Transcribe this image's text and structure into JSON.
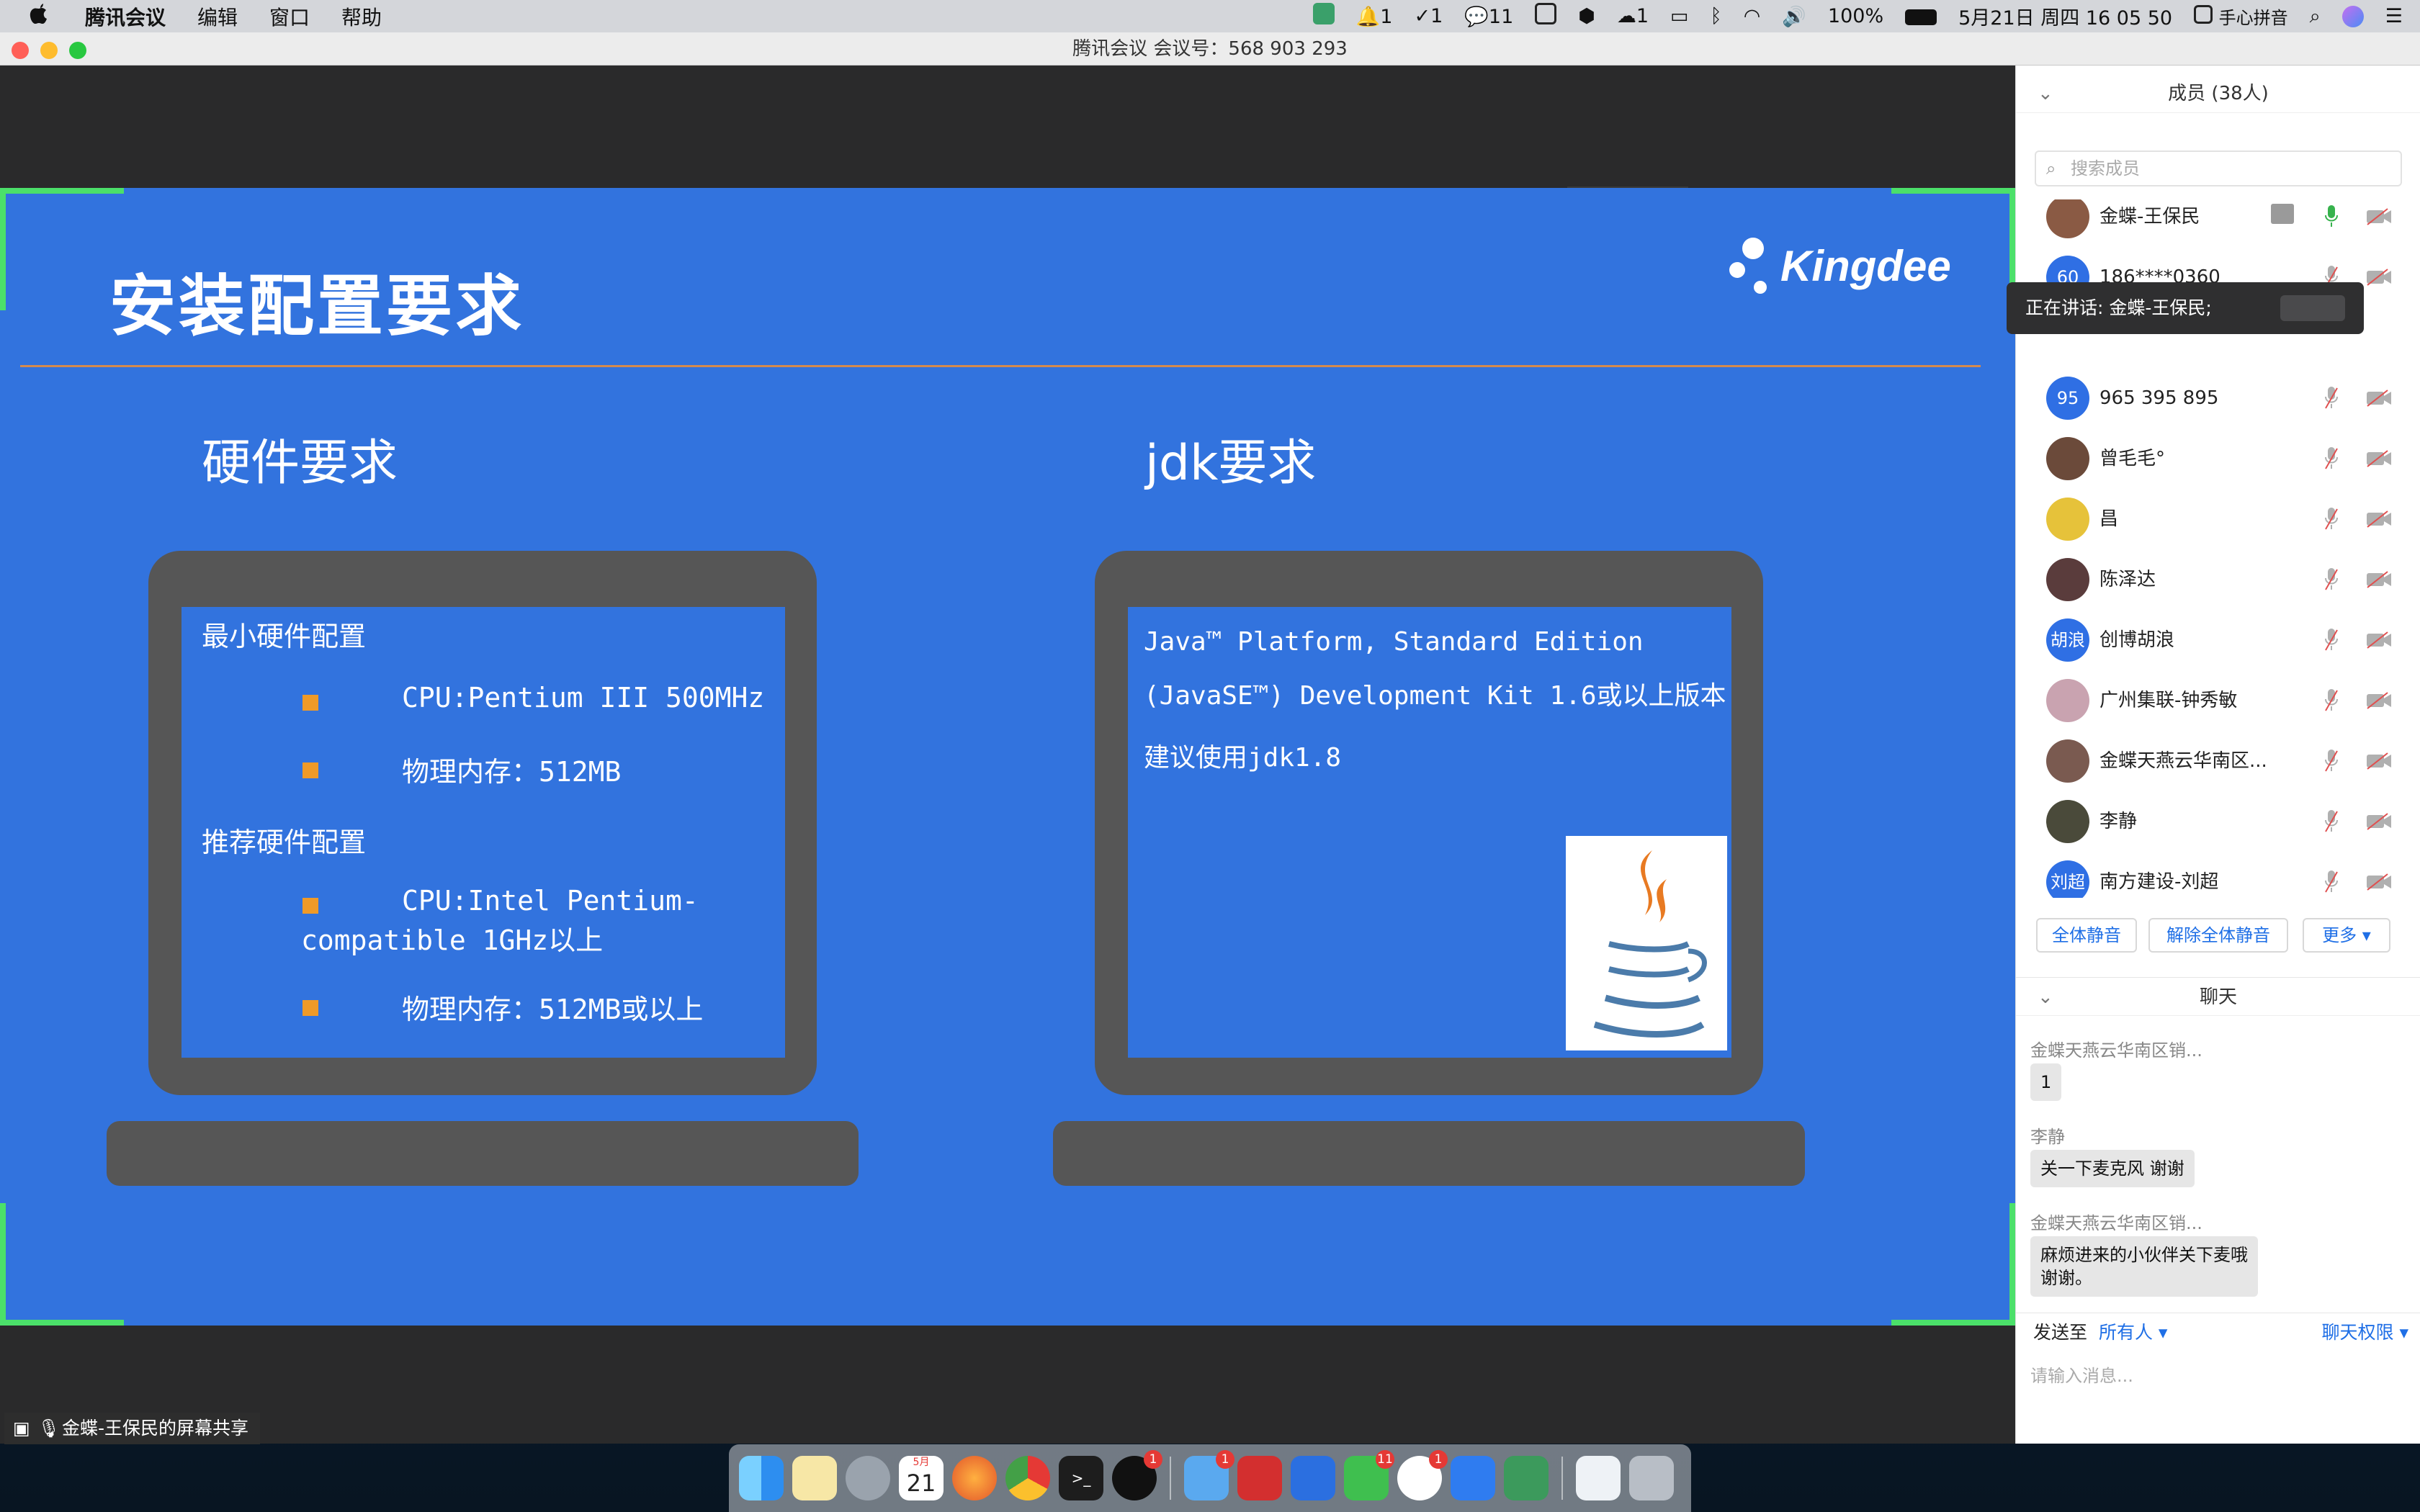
{
  "menubar": {
    "apple": "",
    "app_name": "腾讯会议",
    "menus": [
      "编辑",
      "窗口",
      "帮助"
    ],
    "status": {
      "notif_count": "1",
      "todo_count": "1",
      "wechat_count": "11",
      "cloud_count": "1",
      "battery": "100%",
      "datetime": "5月21日 周四  16 05 50",
      "input_method": "手心拼音"
    }
  },
  "window": {
    "title": "腾讯会议 会议号：568 903 293"
  },
  "slide": {
    "title": "安装配置要求",
    "logo_text": "Kingdee",
    "hardware": {
      "heading": "硬件要求",
      "min_label": "最小硬件配置",
      "min_items": [
        "CPU:Pentium III 500MHz",
        "物理内存：512MB"
      ],
      "rec_label": "推荐硬件配置",
      "rec_item1_line1": "CPU:Intel Pentium-",
      "rec_item1_line2": "compatible 1GHz以上",
      "rec_item2": "物理内存：512MB或以上"
    },
    "jdk": {
      "heading": "jdk要求",
      "line1": "Java™ Platform, Standard Edition",
      "line2": "(JavaSE™) Development Kit 1.6或以上版本",
      "line3": "建议使用jdk1.8"
    }
  },
  "members": {
    "header": "成员 (38人)",
    "search_placeholder": "搜索成员",
    "speaking": "正在讲话: 金蝶-王保民;",
    "list": [
      {
        "name": "金蝶-王保民",
        "avatar": "",
        "color": "#8a5a44"
      },
      {
        "name": "186****0360",
        "avatar": "60",
        "color": "#2f6fe4"
      },
      {
        "name": "965 395 895",
        "avatar": "95",
        "color": "#2f6fe4"
      },
      {
        "name": "曾毛毛°",
        "avatar": "",
        "color": "#6b4a3a"
      },
      {
        "name": "昌",
        "avatar": "",
        "color": "#e6c23a"
      },
      {
        "name": "陈泽达",
        "avatar": "",
        "color": "#5a3c3c"
      },
      {
        "name": "创博胡浪",
        "avatar": "胡浪",
        "color": "#2f6fe4"
      },
      {
        "name": "广州集联-钟秀敏",
        "avatar": "",
        "color": "#c9a3b0"
      },
      {
        "name": "金蝶天燕云华南区...",
        "avatar": "",
        "color": "#7a5a50"
      },
      {
        "name": "李静",
        "avatar": "",
        "color": "#4a4a3a"
      },
      {
        "name": "南方建设-刘超",
        "avatar": "刘超",
        "color": "#2f6fe4"
      }
    ],
    "buttons": {
      "mute_all": "全体静音",
      "unmute_all": "解除全体静音",
      "more": "更多"
    }
  },
  "chat": {
    "header": "聊天",
    "messages": [
      {
        "sender": "金蝶天燕云华南区销...",
        "text": "1"
      },
      {
        "sender": "李静",
        "text": "关一下麦克风  谢谢"
      },
      {
        "sender": "金蝶天燕云华南区销...",
        "text": "麻烦进来的小伙伴关下麦哦",
        "text2": "谢谢。"
      }
    ],
    "send_to_label": "发送至",
    "send_to_value": "所有人",
    "permission": "聊天权限",
    "input_placeholder": "请输入消息..."
  },
  "share_label": "金蝶-王保民的屏幕共享",
  "dock": {
    "calendar_month": "5月",
    "calendar_day": "21",
    "badges": {
      "qq": "1",
      "cloud": "1",
      "wechat": "11",
      "todo": "1"
    }
  }
}
